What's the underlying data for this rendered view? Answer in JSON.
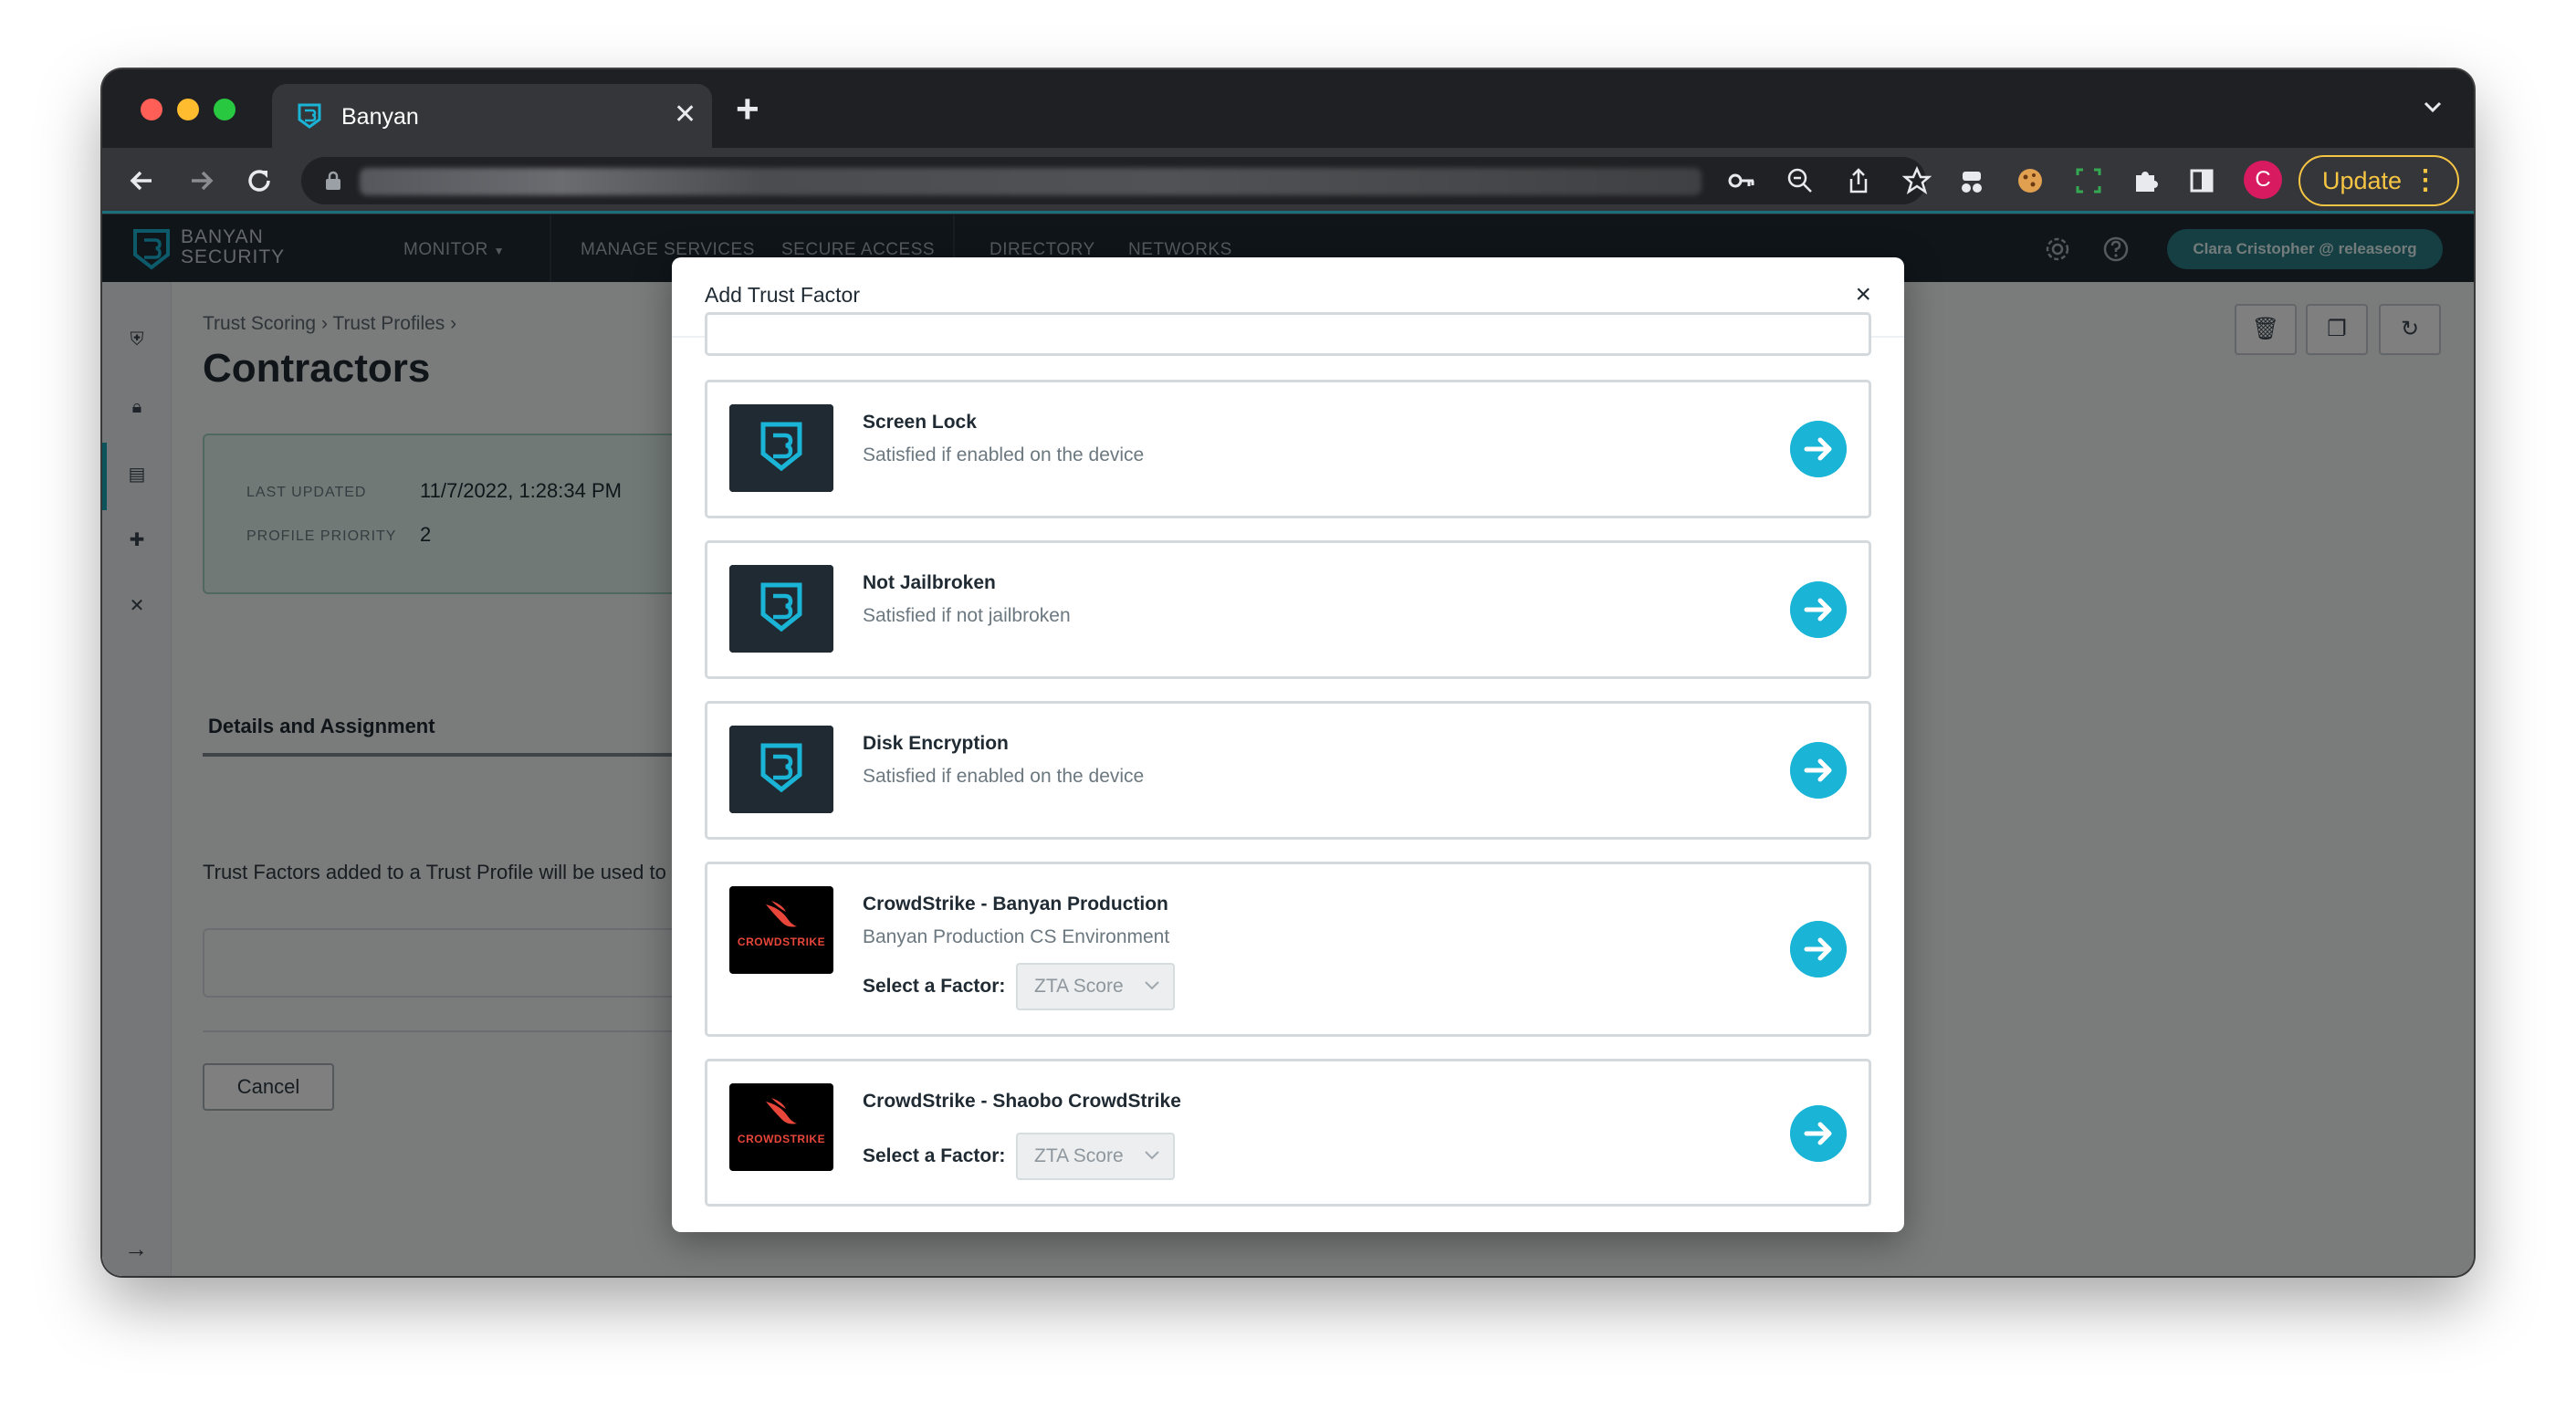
{
  "browser": {
    "tab_title": "Banyan",
    "update_label": "Update",
    "profile_initial": "C"
  },
  "app": {
    "brand": [
      "BANYAN",
      "SECURITY"
    ],
    "nav": [
      "MONITOR",
      "MANAGE SERVICES",
      "SECURE ACCESS",
      "DIRECTORY",
      "NETWORKS"
    ],
    "user": "Clara Cristopher @ releaseorg"
  },
  "page": {
    "breadcrumb": [
      "Trust Scoring",
      "Trust Profiles"
    ],
    "title": "Contractors",
    "info": {
      "last_updated_label": "LAST UPDATED",
      "last_updated_value": "11/7/2022, 1:28:34 PM",
      "priority_label": "PROFILE PRIORITY",
      "priority_value": "2"
    },
    "tab": "Details and Assignment",
    "description": "Trust Factors added to a Trust Profile will be used to",
    "cancel_label": "Cancel"
  },
  "modal": {
    "title": "Add Trust Factor",
    "close": "×",
    "factors": [
      {
        "name": "Screen Lock",
        "subtitle": "Satisfied if enabled on the device",
        "logo": "banyan-logo-icon"
      },
      {
        "name": "Not Jailbroken",
        "subtitle": "Satisfied if not jailbroken",
        "logo": "banyan-logo-icon"
      },
      {
        "name": "Disk Encryption",
        "subtitle": "Satisfied if enabled on the device",
        "logo": "banyan-logo-icon"
      },
      {
        "name": "CrowdStrike - Banyan Production",
        "subtitle": "Banyan Production CS Environment",
        "logo": "crowdstrike-logo-icon",
        "select_label": "Select a Factor:",
        "select_value": "ZTA Score"
      },
      {
        "name": "CrowdStrike - Shaobo CrowdStrike",
        "logo": "crowdstrike-logo-icon",
        "select_label": "Select a Factor:",
        "select_value": "ZTA Score"
      }
    ],
    "cs_wordmark": "CROWDSTRIKE"
  },
  "colors": {
    "accent": "#1ab4d7",
    "header_bg": "#1f2a33",
    "user_pill": "#2a7f86",
    "update_yellow": "#f6c544"
  }
}
